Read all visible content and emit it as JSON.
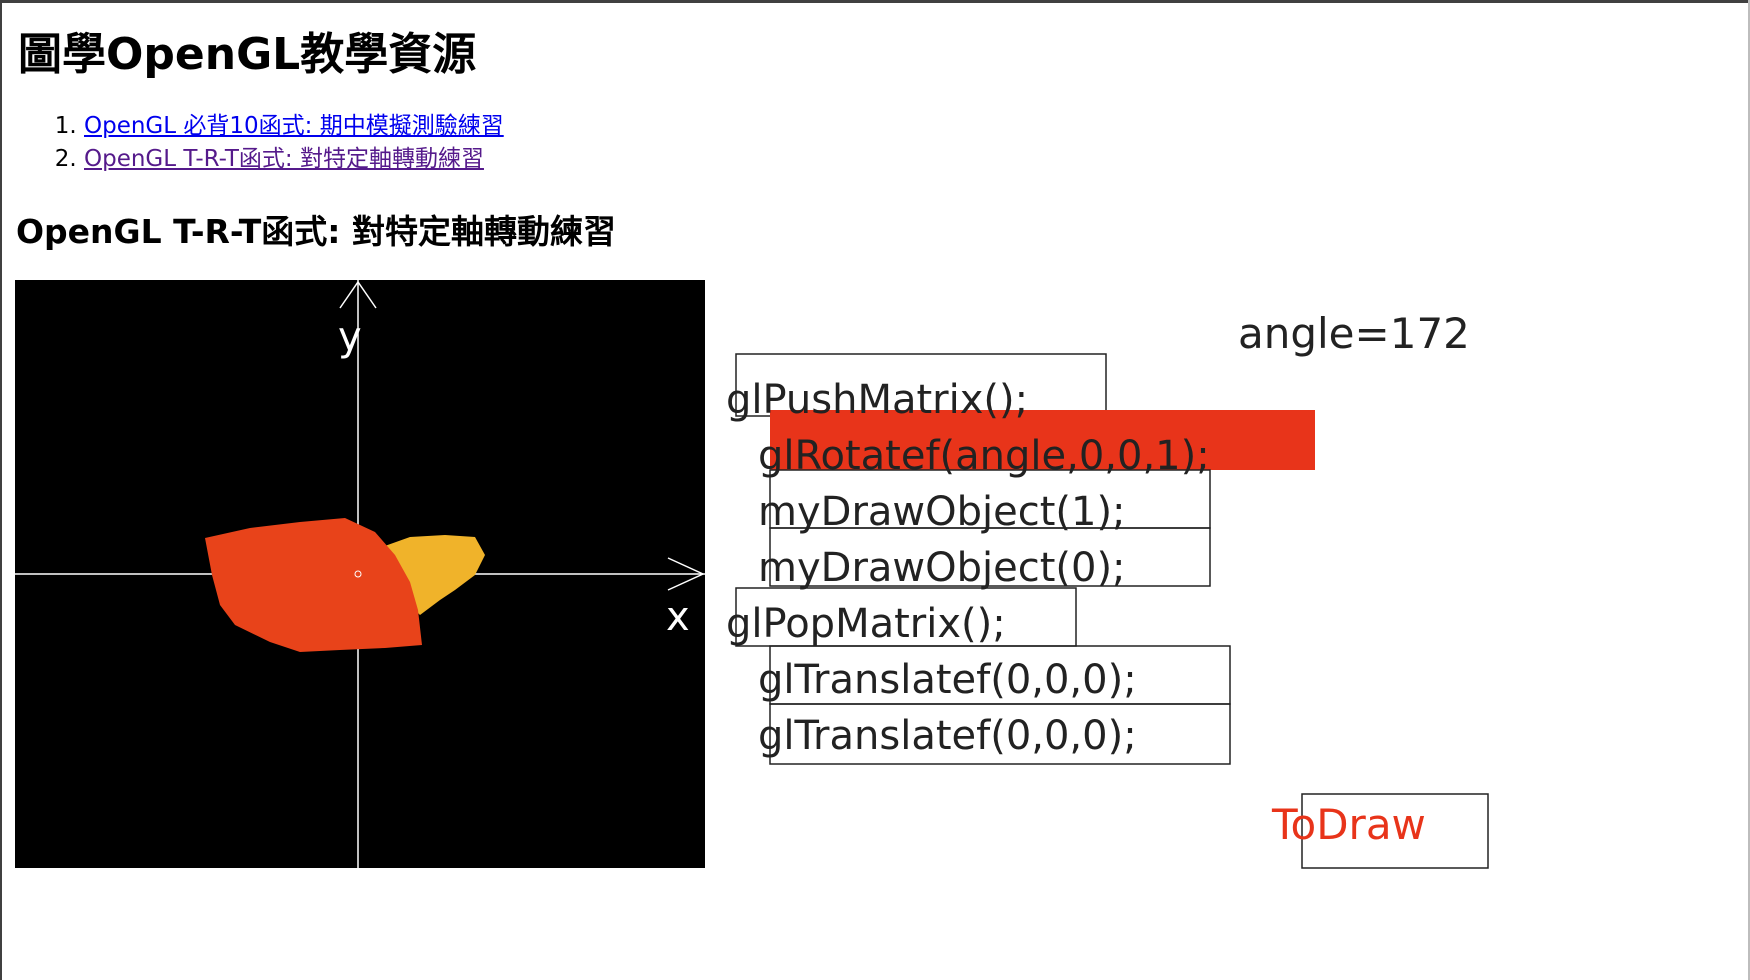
{
  "page": {
    "title": "圖學OpenGL教學資源"
  },
  "links": [
    {
      "label": "OpenGL 必背10函式: 期中模擬測驗練習",
      "visited": false
    },
    {
      "label": "OpenGL T-R-T函式: 對特定軸轉動練習",
      "visited": true
    }
  ],
  "section": {
    "title": "OpenGL T-R-T函式: 對特定軸轉動練習"
  },
  "demo": {
    "axis_x_label": "x",
    "axis_y_label": "y",
    "angle_text": "angle=172",
    "todraw_label": "ToDraw",
    "code_lines": [
      "glPushMatrix();",
      "glRotatef(angle,0,0,1);",
      "myDrawObject(1);",
      "myDrawObject(0);",
      "glPopMatrix();",
      "glTranslatef(0,0,0);",
      "glTranslatef(0,0,0);"
    ],
    "colors": {
      "canvas_bg": "#000000",
      "axis": "#ffffff",
      "shape_large": "#e8431a",
      "shape_small": "#f0b32a",
      "highlight": "#e8341a"
    }
  }
}
